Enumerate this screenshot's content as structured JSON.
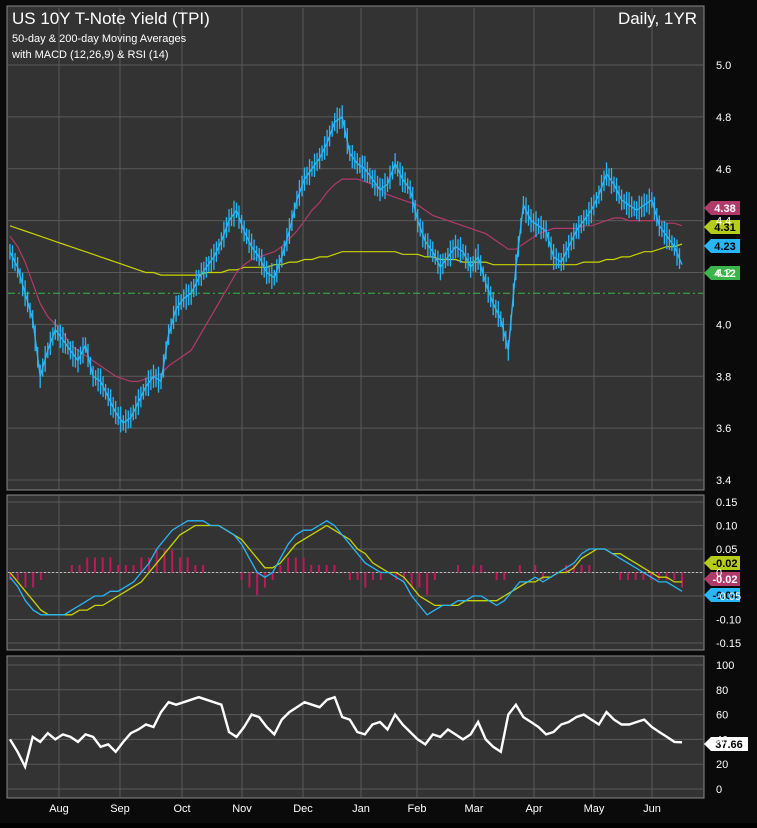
{
  "header": {
    "title": "US 10Y T-Note Yield (TPI)",
    "subtitle1": "50-day & 200-day Moving Averages",
    "subtitle2": "with MACD (12,26,9) & RSI (14)",
    "period": "Daily, 1YR"
  },
  "colors": {
    "price": "#29b6f6",
    "ma50": "#b03a6a",
    "ma200": "#c8d400",
    "support": "#39b54a",
    "macd": "#29b6f6",
    "signal": "#c8d400",
    "histogram": "#c2185b",
    "rsi": "#ffffff"
  },
  "chart_data": [
    {
      "type": "line",
      "panel": "price",
      "ylim": [
        3.4,
        5.0
      ],
      "yticks": [
        "3.4",
        "3.6",
        "3.8",
        "4.0",
        "4.2",
        "4.4",
        "4.6",
        "4.8",
        "5.0"
      ],
      "xticks": [
        "Aug",
        "Sep",
        "Oct",
        "Nov",
        "Dec",
        "Jan",
        "Feb",
        "Mar",
        "Apr",
        "May",
        "Jun"
      ],
      "series": [
        {
          "key": "price",
          "values": [
            4.28,
            4.22,
            4.12,
            4.02,
            3.8,
            3.9,
            3.98,
            3.94,
            3.9,
            3.86,
            3.92,
            3.8,
            3.78,
            3.72,
            3.66,
            3.62,
            3.64,
            3.7,
            3.76,
            3.8,
            3.78,
            3.96,
            4.06,
            4.1,
            4.12,
            4.18,
            4.22,
            4.26,
            4.32,
            4.4,
            4.44,
            4.36,
            4.3,
            4.26,
            4.2,
            4.18,
            4.26,
            4.36,
            4.48,
            4.56,
            4.6,
            4.64,
            4.7,
            4.78,
            4.8,
            4.66,
            4.62,
            4.6,
            4.56,
            4.52,
            4.54,
            4.62,
            4.56,
            4.52,
            4.4,
            4.32,
            4.28,
            4.22,
            4.26,
            4.3,
            4.28,
            4.22,
            4.26,
            4.16,
            4.08,
            4.02,
            3.9,
            4.22,
            4.46,
            4.4,
            4.38,
            4.36,
            4.26,
            4.24,
            4.3,
            4.36,
            4.4,
            4.44,
            4.5,
            4.58,
            4.54,
            4.48,
            4.46,
            4.44,
            4.46,
            4.48,
            4.38,
            4.34,
            4.3,
            4.23
          ]
        },
        {
          "key": "ma50",
          "values": [
            4.34,
            4.3,
            4.24,
            4.16,
            4.08,
            4.03,
            4.0,
            3.97,
            3.92,
            3.9,
            3.88,
            3.86,
            3.84,
            3.82,
            3.8,
            3.79,
            3.78,
            3.78,
            3.79,
            3.8,
            3.81,
            3.84,
            3.86,
            3.88,
            3.9,
            3.95,
            4.0,
            4.05,
            4.1,
            4.15,
            4.2,
            4.23,
            4.25,
            4.26,
            4.27,
            4.28,
            4.3,
            4.33,
            4.36,
            4.4,
            4.44,
            4.47,
            4.51,
            4.54,
            4.56,
            4.56,
            4.56,
            4.55,
            4.54,
            4.52,
            4.5,
            4.49,
            4.48,
            4.47,
            4.46,
            4.44,
            4.42,
            4.41,
            4.4,
            4.39,
            4.38,
            4.37,
            4.36,
            4.35,
            4.33,
            4.31,
            4.29,
            4.29,
            4.31,
            4.33,
            4.35,
            4.36,
            4.37,
            4.37,
            4.37,
            4.37,
            4.38,
            4.38,
            4.39,
            4.4,
            4.41,
            4.41,
            4.4,
            4.4,
            4.4,
            4.4,
            4.4,
            4.39,
            4.39,
            4.38
          ]
        },
        {
          "key": "ma200",
          "values": [
            4.38,
            4.37,
            4.36,
            4.35,
            4.34,
            4.33,
            4.32,
            4.31,
            4.3,
            4.29,
            4.28,
            4.27,
            4.26,
            4.25,
            4.24,
            4.23,
            4.22,
            4.21,
            4.2,
            4.2,
            4.19,
            4.19,
            4.19,
            4.19,
            4.19,
            4.19,
            4.2,
            4.2,
            4.2,
            4.21,
            4.21,
            4.22,
            4.22,
            4.22,
            4.22,
            4.23,
            4.23,
            4.24,
            4.24,
            4.25,
            4.25,
            4.26,
            4.26,
            4.27,
            4.28,
            4.28,
            4.28,
            4.28,
            4.28,
            4.28,
            4.28,
            4.28,
            4.27,
            4.27,
            4.27,
            4.26,
            4.26,
            4.25,
            4.25,
            4.25,
            4.24,
            4.24,
            4.24,
            4.24,
            4.23,
            4.23,
            4.23,
            4.23,
            4.23,
            4.23,
            4.23,
            4.23,
            4.23,
            4.23,
            4.23,
            4.23,
            4.24,
            4.24,
            4.24,
            4.25,
            4.25,
            4.26,
            4.26,
            4.27,
            4.28,
            4.28,
            4.29,
            4.3,
            4.3,
            4.31
          ]
        }
      ],
      "support_level": 4.12,
      "last_values": {
        "ma50": "4.38",
        "ma200": "4.31",
        "price": "4.23",
        "support": "4.12"
      }
    },
    {
      "type": "line",
      "panel": "macd",
      "ylim": [
        -0.15,
        0.15
      ],
      "yticks": [
        "0.15",
        "0.10",
        "0.05",
        "0",
        "-0.05",
        "-0.10",
        "-0.15"
      ],
      "series": [
        {
          "key": "macd",
          "values": [
            -0.01,
            -0.03,
            -0.06,
            -0.08,
            -0.09,
            -0.09,
            -0.09,
            -0.09,
            -0.08,
            -0.07,
            -0.06,
            -0.05,
            -0.05,
            -0.04,
            -0.04,
            -0.03,
            -0.02,
            0.0,
            0.02,
            0.05,
            0.07,
            0.09,
            0.1,
            0.11,
            0.11,
            0.11,
            0.1,
            0.1,
            0.09,
            0.08,
            0.06,
            0.03,
            0.0,
            -0.01,
            0.0,
            0.03,
            0.06,
            0.08,
            0.09,
            0.09,
            0.1,
            0.11,
            0.1,
            0.08,
            0.06,
            0.04,
            0.02,
            0.01,
            0.0,
            0.0,
            -0.01,
            -0.02,
            -0.05,
            -0.07,
            -0.09,
            -0.08,
            -0.07,
            -0.07,
            -0.06,
            -0.06,
            -0.05,
            -0.05,
            -0.06,
            -0.07,
            -0.06,
            -0.04,
            -0.02,
            -0.02,
            -0.01,
            -0.02,
            -0.01,
            0.0,
            0.01,
            0.02,
            0.04,
            0.05,
            0.05,
            0.05,
            0.04,
            0.03,
            0.02,
            0.01,
            0.0,
            -0.01,
            -0.02,
            -0.02,
            -0.03,
            -0.04
          ]
        },
        {
          "key": "signal",
          "values": [
            0.0,
            -0.02,
            -0.04,
            -0.06,
            -0.08,
            -0.09,
            -0.09,
            -0.09,
            -0.09,
            -0.08,
            -0.08,
            -0.07,
            -0.07,
            -0.06,
            -0.05,
            -0.04,
            -0.03,
            -0.02,
            0.0,
            0.02,
            0.04,
            0.06,
            0.08,
            0.09,
            0.1,
            0.1,
            0.1,
            0.1,
            0.09,
            0.08,
            0.07,
            0.05,
            0.03,
            0.01,
            0.01,
            0.02,
            0.04,
            0.06,
            0.07,
            0.08,
            0.09,
            0.1,
            0.09,
            0.08,
            0.07,
            0.05,
            0.04,
            0.02,
            0.01,
            0.0,
            0.0,
            -0.01,
            -0.03,
            -0.05,
            -0.06,
            -0.07,
            -0.07,
            -0.07,
            -0.07,
            -0.06,
            -0.06,
            -0.06,
            -0.06,
            -0.06,
            -0.05,
            -0.04,
            -0.03,
            -0.02,
            -0.02,
            -0.01,
            -0.01,
            0.0,
            0.0,
            0.01,
            0.03,
            0.04,
            0.05,
            0.05,
            0.04,
            0.04,
            0.03,
            0.02,
            0.01,
            0.0,
            -0.01,
            -0.01,
            -0.02,
            -0.02
          ]
        }
      ],
      "last_values": {
        "signal": "-0.02",
        "histogram": "-0.02",
        "macd": "-0.04"
      }
    },
    {
      "type": "line",
      "panel": "rsi",
      "ylim": [
        0,
        100
      ],
      "yticks": [
        "100",
        "80",
        "60",
        "40",
        "20",
        "0"
      ],
      "series": [
        {
          "key": "rsi",
          "values": [
            40,
            30,
            18,
            42,
            38,
            45,
            40,
            44,
            42,
            38,
            44,
            42,
            34,
            36,
            30,
            38,
            45,
            48,
            52,
            50,
            62,
            70,
            68,
            70,
            72,
            74,
            72,
            70,
            68,
            46,
            42,
            50,
            60,
            58,
            50,
            44,
            56,
            62,
            66,
            70,
            68,
            66,
            72,
            74,
            58,
            56,
            46,
            44,
            52,
            54,
            48,
            60,
            52,
            46,
            40,
            36,
            44,
            42,
            48,
            44,
            40,
            44,
            54,
            40,
            34,
            30,
            60,
            68,
            58,
            54,
            50,
            44,
            46,
            52,
            54,
            58,
            60,
            56,
            52,
            62,
            56,
            52,
            52,
            54,
            56,
            50,
            46,
            42,
            38,
            37.66
          ]
        }
      ],
      "last_values": {
        "rsi": "37.66"
      }
    }
  ]
}
